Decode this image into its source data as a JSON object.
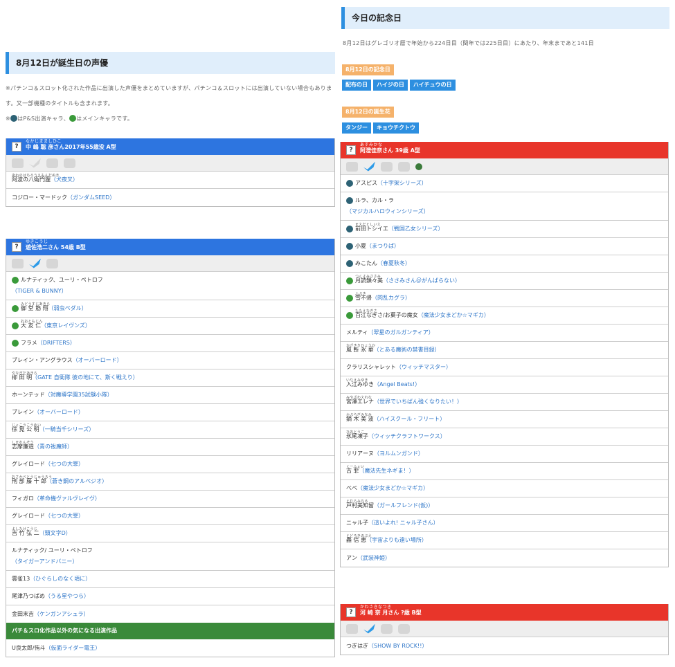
{
  "anniversary": {
    "title": "今日の記念日",
    "desc": "8月12日はグレゴリオ暦で年始から224日目（閏年では225日目）にあたり、年末まであと141日",
    "day_label": "8月12日の記念日",
    "days": [
      "配布の日",
      "ハイジの日",
      "ハイチュウの日"
    ],
    "flower_label": "8月12日の誕生花",
    "flowers": [
      "タンジー",
      "キョウチクトウ"
    ]
  },
  "birthday": {
    "title": "8月12日が誕生日の声優",
    "note1": "※パチンコ＆スロット化された作品に出演した声優をまとめていますが、パチンコ＆スロットには出演していない場合もあります。又一部機種のタイトルも含まれます。",
    "note2a": "※",
    "note2b": "はP&S出演キャラ、",
    "note2c": "はメインキャラです。"
  },
  "cards": {
    "c1": {
      "ruby": "なかじまましひこ",
      "name": "中 嶋 聡 彦さん2017年55歳没 A型",
      "rows": [
        {
          "ruby": "あわのはちろうえもんだぬき",
          "name": "阿波の八衛門狸",
          "work": "（犬夜叉）"
        },
        {
          "ruby": "",
          "name": "コジロー・マードック",
          "work": "（ガンダムSEED）"
        }
      ]
    },
    "c2": {
      "ruby": "ゆきこうじ",
      "name": "遊佐浩二さん 54歳 B型",
      "rows": [
        {
          "ruby": "",
          "name": "ルナティック、ユーリ・ペトロフ",
          "work": "（TIGER & BUNNY）",
          "icon": "x",
          "wrap": true
        },
        {
          "ruby": "みどうすじあきら",
          "name": "御 堂 筋 翔",
          "work": "（弱虫ペダル）",
          "icon": "x"
        },
        {
          "ruby": "おおともじん",
          "name": "大 友 仁",
          "work": "（東京レイヴンズ）",
          "icon": "x"
        },
        {
          "ruby": "",
          "name": "フラメ",
          "work": "（DRIFTERS）",
          "icon": "x"
        },
        {
          "ruby": "",
          "name": "ブレイン・アングラウス",
          "work": "（オーバーロード）"
        },
        {
          "ruby": "やなぎだあきら",
          "name": "柳 田 明",
          "work": "（GATE 自衛隊 彼の地にて、斯く戦えり）"
        },
        {
          "ruby": "",
          "name": "ホーンテッド",
          "work": "（対魔導学園35試験小隊）"
        },
        {
          "ruby": "",
          "name": "ブレイン",
          "work": "（オーバーロード）"
        },
        {
          "ruby": "じょこうこうめい",
          "name": "徐 晃 公 明",
          "work": "（一騎当千シリーズ）"
        },
        {
          "ruby": "しまれんぞう",
          "name": "志摩廉造",
          "work": "（青の祓魔師）"
        },
        {
          "ruby": "",
          "name": "グレイロード",
          "work": "（七つの大罪）"
        },
        {
          "ruby": "おさかべとうじゅうろう",
          "name": "刑 部 藤 十 郎",
          "work": "（蒼き鋼のアルペジオ）"
        },
        {
          "ruby": "",
          "name": "フィガロ",
          "work": "（革命機ヴァルヴレイヴ）"
        },
        {
          "ruby": "",
          "name": "グレイロード",
          "work": "（七つの大罪）"
        },
        {
          "ruby": "よしたけこうじ",
          "name": "吉 竹 弘 二",
          "work": "（頭文字D）"
        },
        {
          "ruby": "",
          "name": "ルナティック/ ユーリ・ペトロフ",
          "work": "（タイガーアンドバニー）",
          "wrap": true
        },
        {
          "ruby": "",
          "name": "雲雀13",
          "work": "（ひぐらしのなく頃に）"
        },
        {
          "ruby": "",
          "name": "尾津乃つばめ",
          "work": "（うる星やつら）"
        },
        {
          "ruby": "",
          "name": "金田末吉",
          "work": "（ケンガンアシュラ）"
        }
      ],
      "extra_title": "パチ＆スロ化作品以外の気になる出演作品",
      "extra_rows": [
        {
          "ruby": "",
          "name": "U良太郎/侑斗",
          "work": "（仮面ライダー電王）"
        }
      ]
    },
    "c3": {
      "ruby": "あすみかな",
      "name": "阿澄佳奈さん 39歳 A型",
      "rows": [
        {
          "ruby": "",
          "name": "アスピス",
          "work": "（十字架シリーズ）",
          "icon": "o"
        },
        {
          "ruby": "",
          "name": "ルラ、カル・ラ",
          "work": "（マジカルハロウィンシリーズ）",
          "icon": "o",
          "wrap": true
        },
        {
          "ruby": "まえだとしいえ",
          "name": "前田トシイエ",
          "work": "（戦国乙女シリーズ）",
          "icon": "o"
        },
        {
          "ruby": "",
          "name": "小夏",
          "work": "（まつりば）",
          "icon": "o"
        },
        {
          "ruby": "",
          "name": "みこたん",
          "work": "（春夏秋冬）",
          "icon": "o"
        },
        {
          "ruby": "つくよみささみ",
          "name": "月読鎖々美",
          "work": "（ささみさん＠がんばらない）",
          "icon": "x"
        },
        {
          "ruby": "ふぶき",
          "name": "雪不帰",
          "work": "（閃乱カグラ）",
          "icon": "x"
        },
        {
          "ruby": "ももえなぎさ",
          "name": "百江なぎさ/お菓子の魔女",
          "work": "（魔法少女まどか☆マギカ）",
          "icon": "x"
        },
        {
          "ruby": "",
          "name": "メルティ",
          "work": "（翠星のガルガンティア）"
        },
        {
          "ruby": "かざきりひょうか",
          "name": "風 斬 氷 華",
          "work": "（とある魔術の禁書目録）"
        },
        {
          "ruby": "",
          "name": "クラリスシャレット",
          "work": "（ウィッチマスター）"
        },
        {
          "ruby": "いりえみゆき",
          "name": "入江みゆき",
          "work": "（Angel Beats!）"
        },
        {
          "ruby": "みやざわえれな",
          "name": "宮澤エレナ",
          "work": "（世界でいちばん強くなりたい！）"
        },
        {
          "ruby": "かぶらぎみなみ",
          "name": "鏑 木 美 波",
          "work": "（ハイスクール・フリート）"
        },
        {
          "ruby": "ひおとうこ",
          "name": "氷尾凍子",
          "work": "（ウィッチクラフトワークス）"
        },
        {
          "ruby": "",
          "name": "リリアーヌ",
          "work": "（ヨルムンガンド）"
        },
        {
          "ruby": "くーふぇい",
          "name": "古 菲",
          "work": "（魔法先生ネギま！）"
        },
        {
          "ruby": "",
          "name": "べべ",
          "work": "（魔法少女まどか☆マギカ）"
        },
        {
          "ruby": "とむらみちる",
          "name": "戸村美知留",
          "work": "（ガールフレンド(仮)）"
        },
        {
          "ruby": "",
          "name": "ニャル子",
          "work": "（這いよれ! ニャル子さん）"
        },
        {
          "ruby": "とどろきのぶえ",
          "name": "轟 信 恵",
          "work": "（宇宙よりも遠い場所）"
        },
        {
          "ruby": "",
          "name": "アン",
          "work": "（武装神姫）"
        }
      ]
    },
    "c4": {
      "ruby": "かわさきなつき",
      "name": "河 崎 奈 月さん ?歳 B型",
      "rows": [
        {
          "ruby": "",
          "name": "つぎはぎ",
          "work": "（SHOW BY ROCK!!）"
        }
      ]
    }
  }
}
